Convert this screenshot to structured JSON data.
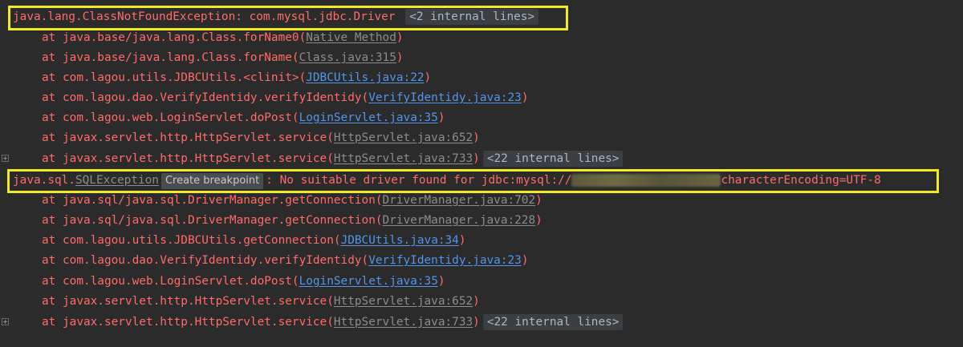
{
  "block1": {
    "exception": "java.lang.ClassNotFoundException: com.mysql.jdbc.Driver",
    "internal_badge": "<2 internal lines>",
    "frames": [
      {
        "prefix": "at java.base/java.lang.Class.forName0(",
        "link": "Native Method",
        "suffix": ")"
      },
      {
        "prefix": "at java.base/java.lang.Class.forName(",
        "link": "Class.java:315",
        "suffix": ")"
      },
      {
        "prefix": "at com.lagou.utils.JDBCUtils.<clinit>(",
        "link": "JDBCUtils.java:22",
        "suffix": ")"
      },
      {
        "prefix": "at com.lagou.dao.VerifyIdentidy.verifyIdentidy(",
        "link": "VerifyIdentidy.java:23",
        "suffix": ")"
      },
      {
        "prefix": "at com.lagou.web.LoginServlet.doPost(",
        "link": "LoginServlet.java:35",
        "suffix": ")"
      },
      {
        "prefix": "at javax.servlet.http.HttpServlet.service(",
        "link": "HttpServlet.java:652",
        "suffix": ")"
      },
      {
        "prefix": "at javax.servlet.http.HttpServlet.service(",
        "link": "HttpServlet.java:733",
        "suffix": ")",
        "badge": "<22 internal lines>"
      }
    ]
  },
  "block2": {
    "exception_prefix": "java.sql.",
    "exception_link": "SQLException",
    "tooltip": "Create breakpoint",
    "message_prefix": ": No suitable driver found for jdbc:mysql://",
    "message_suffix": "characterEncoding=UTF-8",
    "frames": [
      {
        "prefix": "at java.sql/java.sql.DriverManager.getConnection(",
        "link": "DriverManager.java:702",
        "suffix": ")"
      },
      {
        "prefix": "at java.sql/java.sql.DriverManager.getConnection(",
        "link": "DriverManager.java:228",
        "suffix": ")"
      },
      {
        "prefix": "at com.lagou.utils.JDBCUtils.getConnection(",
        "link": "JDBCUtils.java:34",
        "suffix": ")"
      },
      {
        "prefix": "at com.lagou.dao.VerifyIdentidy.verifyIdentidy(",
        "link": "VerifyIdentidy.java:23",
        "suffix": ")"
      },
      {
        "prefix": "at com.lagou.web.LoginServlet.doPost(",
        "link": "LoginServlet.java:35",
        "suffix": ")"
      },
      {
        "prefix": "at javax.servlet.http.HttpServlet.service(",
        "link": "HttpServlet.java:652",
        "suffix": ")"
      },
      {
        "prefix": "at javax.servlet.http.HttpServlet.service(",
        "link": "HttpServlet.java:733",
        "suffix": ")",
        "badge": "<22 internal lines>"
      }
    ]
  },
  "colors": {
    "background": "#2b2b2b",
    "error_text": "#ff6b68",
    "project_link": "#5394ec",
    "library_link": "#8c8c8c",
    "highlight_box": "#f2ea22"
  }
}
